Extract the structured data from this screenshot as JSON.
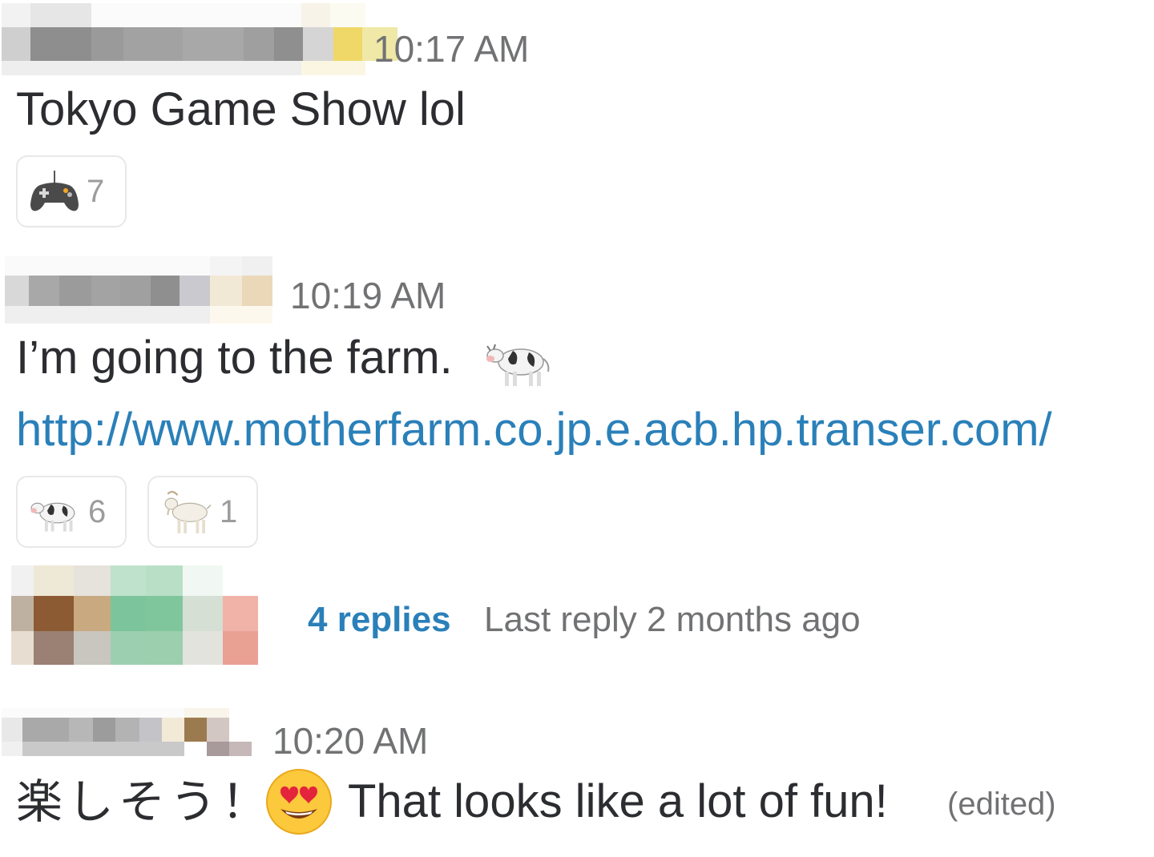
{
  "messages": [
    {
      "time": "10:17 AM",
      "text": "Tokyo Game Show lol",
      "reactions": [
        {
          "emoji": "video-game-controller-icon",
          "count": "7"
        }
      ]
    },
    {
      "time": "10:19 AM",
      "text": "I’m going to the farm.",
      "trailing_emoji": "cow-icon",
      "link": "http://www.motherfarm.co.jp.e.acb.hp.transer.com/",
      "reactions": [
        {
          "emoji": "cow-icon",
          "count": "6"
        },
        {
          "emoji": "goat-icon",
          "count": "1"
        }
      ],
      "thread": {
        "replies_label": "4 replies",
        "last_reply": "Last reply 2 months ago"
      }
    },
    {
      "time": "10:20 AM",
      "text_jp": "楽しそう！",
      "emoji": "heart-eyes-face-icon",
      "text_en": "That looks like a lot of fun!",
      "edited_label": "(edited)"
    }
  ],
  "colors": {
    "link": "#2a80b9",
    "text": "#2c2d30",
    "muted": "#717274",
    "reaction_border": "#e8e8e8"
  }
}
